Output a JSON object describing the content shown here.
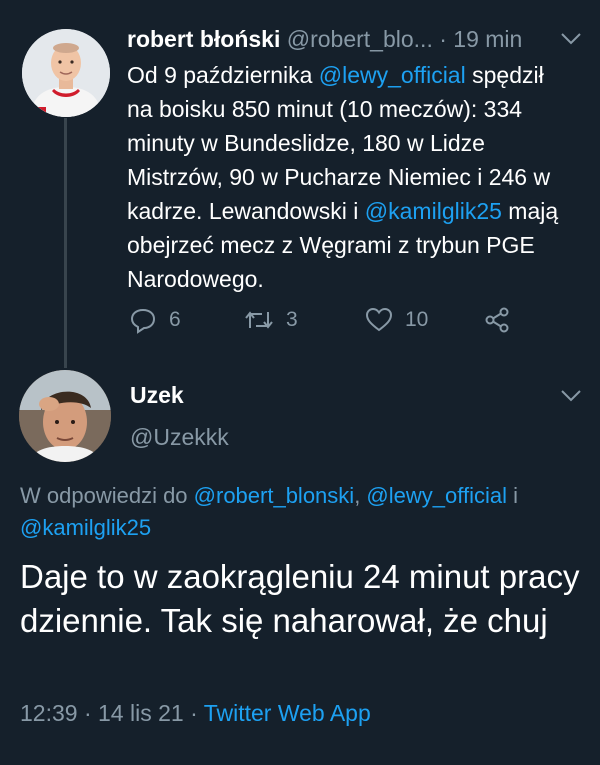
{
  "parent": {
    "name": "robert błoński",
    "handle": "@robert_blo...",
    "separator": "·",
    "time": "19 min",
    "text": {
      "part1": "Od 9 października ",
      "mention1": "@lewy_official",
      "part2": " spędził na boisku 850 minut (10 meczów): 334 minuty w Bundeslidze, 180 w Lidze Mistrzów, 90 w Pucharze Niemiec i 246 w kadrze. Lewandowski i ",
      "mention2": "@kamilglik25",
      "part3": " mają obejrzeć mecz z Węgrami z trybun PGE Narodowego."
    },
    "actions": {
      "reply_count": "6",
      "retweet_count": "3",
      "like_count": "10"
    }
  },
  "reply": {
    "name": "Uzek",
    "handle": "@Uzekkk",
    "replying": {
      "prefix": "W odpowiedzi do ",
      "mention1": "@robert_blonski",
      "sep1": ", ",
      "mention2": "@lewy_official",
      "sep2": " i ",
      "mention3": "@kamilglik25"
    },
    "text": "Daje to w zaokrągleniu 24 minut pracy dziennie. Tak się naharował, że chuj",
    "meta": {
      "time": "12:39",
      "sep1": " · ",
      "date": "14 lis 21",
      "sep2": " · ",
      "app": "Twitter Web App"
    }
  },
  "colors": {
    "background": "#15202b",
    "link": "#1da1f2",
    "muted": "#8899a6",
    "divider": "#38444d"
  }
}
